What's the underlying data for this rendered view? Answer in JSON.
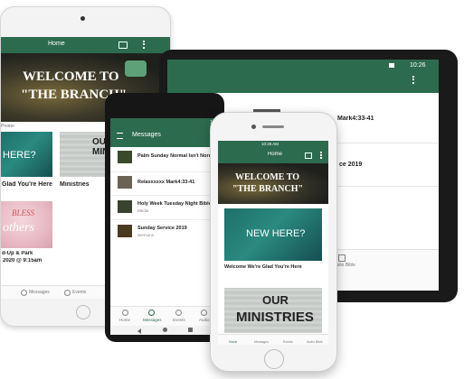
{
  "colors": {
    "header_green": "#2d6b4e",
    "device_black": "#1a1a1a",
    "device_white": "#f5f5f5"
  },
  "tablet_left": {
    "header_title": "Home",
    "hero": {
      "line1": "WELCOME TO",
      "line2": "\"THE BRANCH\""
    },
    "cards": [
      {
        "image_text": "HERE?",
        "caption": "Glad You're Here"
      },
      {
        "image_text": "OUR MINISTRI",
        "caption": "Ministries"
      }
    ],
    "promo": {
      "script_text": "BLESS",
      "script_text2": "others",
      "caption1": "d-Up & Park",
      "caption2": "2020 @ 9:15am"
    },
    "tabs": [
      "Messages",
      "Events"
    ],
    "status_label": "Promo"
  },
  "tablet_right": {
    "status_time": "10:26",
    "rows": [
      {
        "title": "Mark4:33-41"
      },
      {
        "title": "ce 2019"
      }
    ],
    "audio_label": "udio Bible"
  },
  "phone_android": {
    "status_time": "10",
    "header_title": "Messages",
    "messages": [
      {
        "title": "Palm Sunday Normal Isn't Norm",
        "subtitle": ""
      },
      {
        "title": "Relaxxxxxx  Mark4:33-41",
        "subtitle": ""
      },
      {
        "title": "Holy Week Tuesday Night Bible...",
        "subtitle": "Media"
      },
      {
        "title": "Sunday Service 2019",
        "subtitle": "Sermons"
      }
    ],
    "tabs": [
      "Home",
      "Messages",
      "Events",
      "Audio B"
    ]
  },
  "phone_iphone": {
    "status_time": "10:26 AM",
    "header_title": "Home",
    "hero": {
      "line1": "WELCOME TO",
      "line2": "\"THE BRANCH\""
    },
    "new_here": {
      "image_text": "NEW HERE?",
      "caption": "Welcome We're Glad You're Here"
    },
    "ministries": {
      "line1": "OUR",
      "line2": "MINISTRIES"
    },
    "tabs": [
      "Home",
      "Messages",
      "Events",
      "Audio Bible"
    ]
  }
}
